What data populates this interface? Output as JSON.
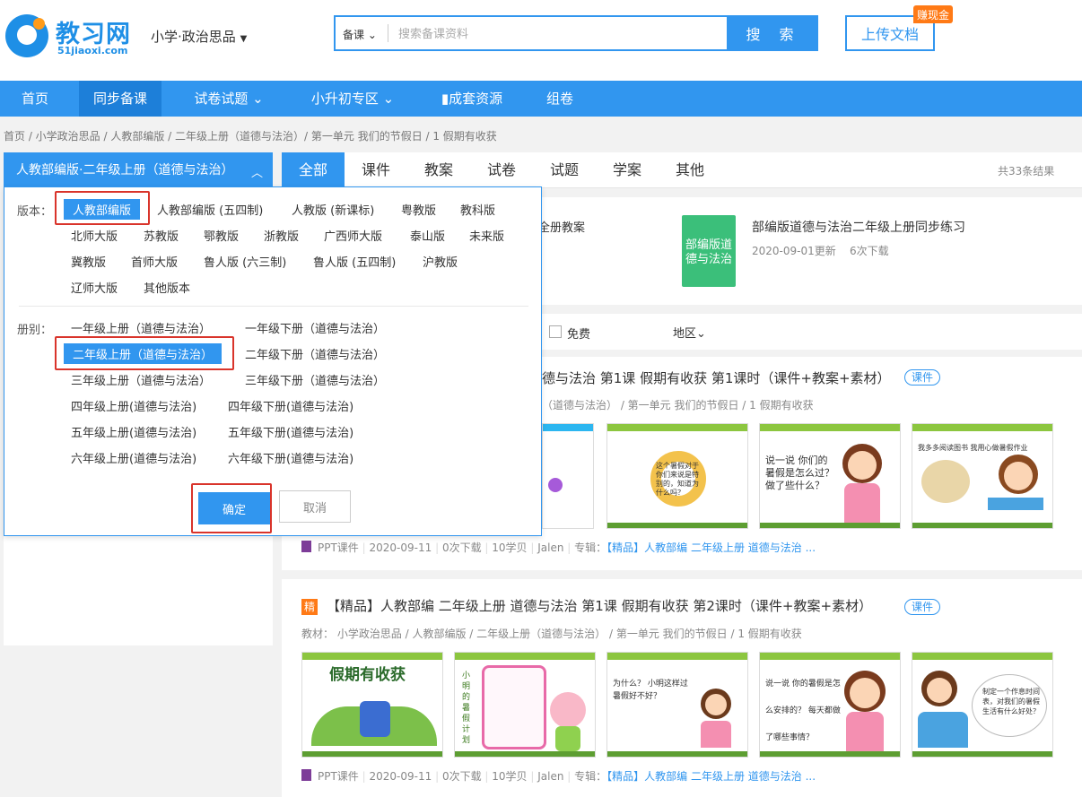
{
  "header": {
    "logo_title": "教习网",
    "logo_sub": "51jiaoxi.com",
    "subject": "小学·政治思品",
    "search_type": "备课",
    "search_placeholder": "搜索备课资料",
    "search_button": "搜 索",
    "upload_button": "上传文档",
    "earn_badge": "赚现金"
  },
  "nav": {
    "items": [
      {
        "label": "首页"
      },
      {
        "label": "同步备课"
      },
      {
        "label": "试卷试题 ⌄"
      },
      {
        "label": "小升初专区 ⌄"
      },
      {
        "label": "▮成套资源"
      },
      {
        "label": "组卷"
      }
    ]
  },
  "breadcrumb": "首页 / 小学政治思品 / 人教部编版 / 二年级上册（道德与法治）/ 第一单元 我们的节假日 / 1 假期有收获",
  "filter_head": {
    "label": "人教部编版·二年级上册（道德与法治）",
    "chevron": "︿"
  },
  "tabs": [
    {
      "label": "全部"
    },
    {
      "label": "课件"
    },
    {
      "label": "教案"
    },
    {
      "label": "试卷"
    },
    {
      "label": "试题"
    },
    {
      "label": "学案"
    },
    {
      "label": "其他"
    }
  ],
  "result_count": "共33条结果",
  "featured": {
    "item1_title": "全册教案",
    "item2_cover_text": "部编版道德与法治",
    "item2_title": "部编版道德与法治二年级上册同步练习",
    "item2_date": "2020-09-01更新",
    "item2_downloads": "6次下载"
  },
  "filters": {
    "free_label": "免费",
    "region_label": "地区⌄"
  },
  "dropdown": {
    "edition_label": "版本：",
    "editions": [
      "人教部编版",
      "人教部编版 (五四制)",
      "人教版 (新课标)",
      "粤教版",
      "教科版",
      "北师大版",
      "苏教版",
      "鄂教版",
      "浙教版",
      "广西师大版",
      "泰山版",
      "未来版",
      "冀教版",
      "首师大版",
      "鲁人版 (六三制)",
      "鲁人版 (五四制)",
      "沪教版",
      "辽师大版",
      "其他版本"
    ],
    "volume_label": "册别：",
    "volumes": [
      "一年级上册（道德与法治）",
      "一年级下册（道德与法治）",
      "二年级上册（道德与法治）",
      "二年级下册（道德与法治）",
      "三年级上册（道德与法治）",
      "三年级下册（道德与法治）",
      "四年级上册(道德与法治)",
      "四年级下册(道德与法治)",
      "五年级上册(道德与法治)",
      "五年级下册(道德与法治)",
      "六年级上册(道德与法治)",
      "六年级下册(道德与法治)"
    ],
    "confirm": "确定",
    "cancel": "取消"
  },
  "results": [
    {
      "title": "德与法治 第1课 假期有收获 第1课时（课件+教案+素材）",
      "tag": "课件",
      "path": "（道德与法治） / 第一单元 我们的节假日 / 1 假期有收获",
      "thumbs": [
        "这个暑假对于你们来说是特别的，知道为什么吗？",
        "说一说 你们的暑假是怎么过？ 做了些什么？",
        "我多多阅读图书 我用心做暑假作业"
      ],
      "meta_type": "PPT课件",
      "meta_date": "2020-09-11",
      "meta_downloads": "0次下载",
      "meta_points": "10学贝",
      "meta_author": "Jalen",
      "meta_album_label": "专辑：",
      "meta_album": "【精品】人教部编 二年级上册 道德与法治 ..."
    },
    {
      "badge": "精",
      "title": "【精品】人教部编 二年级上册 道德与法治 第1课 假期有收获 第2课时（课件+教案+素材）",
      "tag": "课件",
      "path": "教材： 小学政治思品 / 人教部编版 / 二年级上册（道德与法治） / 第一单元 我们的节假日 / 1 假期有收获",
      "thumbs": [
        "假期有收获",
        "小明的暑假计划",
        "为什么？ 小明这样过暑假好不好？",
        "说一说 你的暑假是怎么安排的？ 每天都做了哪些事情？",
        "制定一个作息时间表，对我们的暑假生活有什么好处？"
      ],
      "meta_type": "PPT课件",
      "meta_date": "2020-09-11",
      "meta_downloads": "0次下载",
      "meta_points": "10学贝",
      "meta_author": "Jalen",
      "meta_album_label": "专辑：",
      "meta_album": "【精品】人教部编 二年级上册 道德与法治 ..."
    }
  ],
  "colors": {
    "primary": "#3196ef",
    "accent": "#ff7a16",
    "highlight": "#d9342b"
  }
}
